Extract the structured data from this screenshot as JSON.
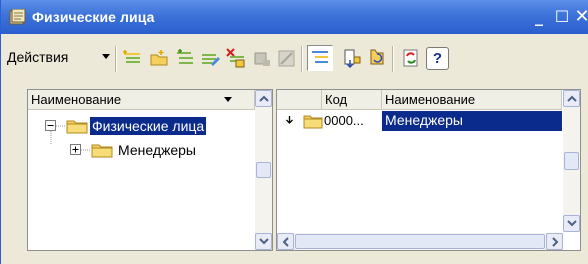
{
  "window": {
    "title": "Физические лица",
    "controls": {
      "minimize": "_",
      "maximize": "☐",
      "close": "✕"
    }
  },
  "toolbar": {
    "actions_label": "Действия",
    "buttons": [
      "add-element-icon",
      "add-group-icon",
      "copy-icon",
      "edit-icon",
      "delete-mark-icon",
      "post-icon",
      "unpost-icon",
      "hierarchy-icon",
      "level-up-icon",
      "history-icon",
      "refresh-icon",
      "help-icon"
    ],
    "help_label": "?"
  },
  "left_panel": {
    "column_header": "Наименование",
    "tree": [
      {
        "label": "Физические лица",
        "expanded": true,
        "selected": true
      },
      {
        "label": "Менеджеры",
        "expanded": false,
        "selected": false
      }
    ]
  },
  "right_panel": {
    "columns": [
      "Код",
      "Наименование"
    ],
    "rows": [
      {
        "code": "0000...",
        "name": "Менеджеры",
        "selected": true
      }
    ]
  },
  "colors": {
    "titlebar": "#2b5fcf",
    "selection": "#0a2a8c",
    "window_bg": "#ece9d8",
    "folder": "#f4cf5c"
  }
}
